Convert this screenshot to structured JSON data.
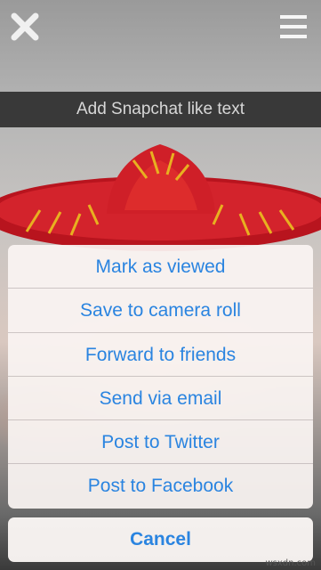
{
  "caption": {
    "text": "Add Snapchat like text"
  },
  "toolbar": {
    "close_icon": "close-icon",
    "menu_icon": "hamburger-menu-icon"
  },
  "action_sheet": {
    "items": [
      {
        "label": "Mark as viewed"
      },
      {
        "label": "Save to camera roll"
      },
      {
        "label": "Forward to friends"
      },
      {
        "label": "Send via email"
      },
      {
        "label": "Post to Twitter"
      },
      {
        "label": "Post to Facebook"
      }
    ],
    "cancel_label": "Cancel"
  },
  "watermark": "wsxdn.com",
  "colors": {
    "accent": "#2a84e0",
    "caption_bg": "#282828",
    "sombrero_red": "#c8202a",
    "sombrero_gold": "#e8b020"
  }
}
